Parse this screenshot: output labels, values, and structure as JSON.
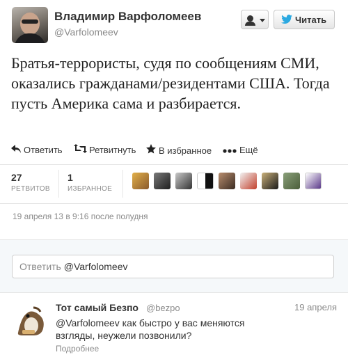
{
  "tweet": {
    "author_name": "Владимир Варфоломеев",
    "author_handle": "@Varfolomeev",
    "text": "Братья-террористы, судя по сообщениям СМИ, оказались гражданами/резидентами США. Тогда пусть Америка сама и разбирается.",
    "timestamp": "19 апреля 13 в 9:16 после полудня"
  },
  "header": {
    "follow_label": "Читать",
    "icons": {
      "follow_menu": "person-caret-icon",
      "follow": "twitter-bird-icon"
    },
    "accent": "#2ba9e1"
  },
  "actions": {
    "reply": "Ответить",
    "retweet": "Ретвитнуть",
    "favorite": "В избранное",
    "more": "Ещё"
  },
  "stats": {
    "retweets_count": "27",
    "retweets_label": "РЕТВИТОВ",
    "favorites_count": "1",
    "favorites_label": "ИЗБРАННОЕ"
  },
  "reply_box": {
    "prefix": "Ответить",
    "handle": "@Varfolomeev"
  },
  "reply": {
    "name": "Тот самый Безпо",
    "handle": "@bezpo",
    "date": "19 апреля",
    "text": "@Varfolomeev как быстро у вас меняются взгляды, неужели позвонили?",
    "more": "Подробнее"
  }
}
